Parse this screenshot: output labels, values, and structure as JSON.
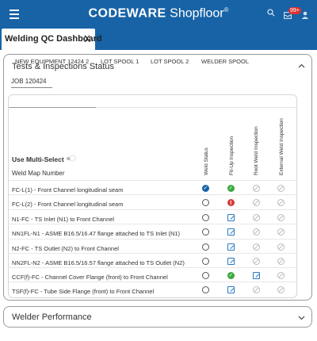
{
  "header": {
    "brand_bold": "CODEWARE",
    "brand_light": "Shopfloor",
    "brand_mark": "®",
    "badge": "99+"
  },
  "tab": {
    "label": "Welding QC Dashboard",
    "close": "X"
  },
  "panel1": {
    "title": "Tests & Inspections Status",
    "job": "JOB 120424",
    "subtabs": [
      "NEW EQUIPMENT 12424 2",
      "LOT SPOOL 1",
      "LOT SPOOL 2",
      "WELDER SPOOL"
    ],
    "multi_select_label": "Use Multi-Select",
    "weld_map_header": "Weld Map Number",
    "columns": [
      "Weld Status",
      "Fit-Up Inspection",
      "Root Weld Inspection",
      "External Weld Inspection"
    ],
    "rows": [
      {
        "label": "FC-L(1) - Front Channel longitudinal seam",
        "status": [
          "done",
          "green",
          "na",
          "na"
        ]
      },
      {
        "label": "FC-L(2) - Front Channel longitudinal seam",
        "status": [
          "empty",
          "red",
          "na",
          "na"
        ]
      },
      {
        "label": "N1-FC - TS Inlet (N1) to Front Channel",
        "status": [
          "empty",
          "edit",
          "na",
          "na"
        ]
      },
      {
        "label": "NN1FL-N1 - ASME B16.5/16.47 flange attached to TS Inlet (N1)",
        "status": [
          "empty",
          "edit",
          "na",
          "na"
        ]
      },
      {
        "label": "N2-FC - TS Outlet (N2) to Front Channel",
        "status": [
          "empty",
          "edit",
          "na",
          "na"
        ]
      },
      {
        "label": "NN2FL-N2 - ASME B16.5/16.57 flange attached to TS Outlet (N2)",
        "status": [
          "empty",
          "edit",
          "na",
          "na"
        ]
      },
      {
        "label": "CCF(f)-FC - Channel Cover Flange (front) to Front Channel",
        "status": [
          "empty",
          "green",
          "edit",
          "na"
        ]
      },
      {
        "label": "TSF(f)-FC - Tube Side Flange (front) to Front Channel",
        "status": [
          "empty",
          "edit",
          "na",
          "na"
        ]
      }
    ]
  },
  "panel2": {
    "title": "Welder Performance"
  },
  "icons": {
    "menu": "hamburger-icon",
    "search": "search-icon",
    "inbox": "inbox-icon",
    "user": "user-icon",
    "collapse": "chevron-up-icon",
    "expand": "chevron-down-icon"
  },
  "colors": {
    "brand": "#1763a6",
    "done": "#1763a6",
    "passed": "#3ba93b",
    "failed": "#d43a3a",
    "pending": "#2a7ac0"
  }
}
